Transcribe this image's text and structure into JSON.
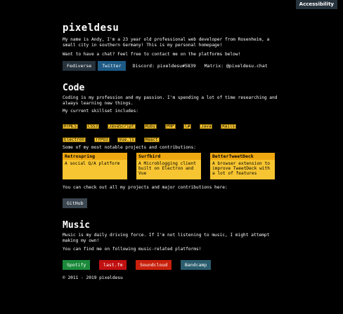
{
  "accessibility": "Accessibility",
  "title": "pixeldesu",
  "intro": "My name is Andy, I'm a 23 year old professional web developer from Rosenheim, a small city in southern Germany! This is my personal homepage!",
  "chat_text": "Want to have a chat? Feel free to contact me on the platforms below!",
  "contact": {
    "buttons": [
      {
        "label": "Fediverse",
        "color": "#26323c"
      },
      {
        "label": "Twitter",
        "color": "#1d5a85"
      }
    ],
    "discord": "Discord: pixeldesu#5839",
    "matrix": "Matrix: @pixeldesu.chat"
  },
  "code": {
    "heading": "Code",
    "text": "Coding is my profession and my passion. I'm spending a lot of time researching and always learning new things.",
    "skills_label": "My current skillset includes:",
    "skills": [
      "HTML5",
      "CSS3",
      "JavaScript",
      "Ruby",
      "PHP",
      "C#",
      "Java",
      "Rails",
      "Electron",
      "TYPO3",
      "Vue.js",
      "React"
    ],
    "projects_label": "Some of my most notable projects and contributions:",
    "projects": [
      {
        "name": "Retrospring",
        "desc": "A social Q/A platform"
      },
      {
        "name": "Surfbird",
        "desc": "A Microblogging client built on Electron and Vue"
      },
      {
        "name": "BetterTweetDeck",
        "desc": "A browser extension to improve TweetDeck with a lot of features"
      }
    ],
    "github_text": "You can check out all my projects and major contributions here:",
    "github": "GitHub"
  },
  "music": {
    "heading": "Music",
    "text": "Music is my daily driving force. If I'm not listening to music, I might attempt making my own!",
    "platforms_label": "You can find me on following music-related platforms!",
    "platforms": [
      {
        "label": "Spotify",
        "color": "#1a8a3a"
      },
      {
        "label": "last.fm",
        "color": "#c01010"
      },
      {
        "label": "Soundcloud",
        "color": "#c8200c"
      },
      {
        "label": "Bandcamp",
        "color": "#2b5d6e"
      }
    ]
  },
  "footer": "© 2011 - 2019 pixeldesu"
}
